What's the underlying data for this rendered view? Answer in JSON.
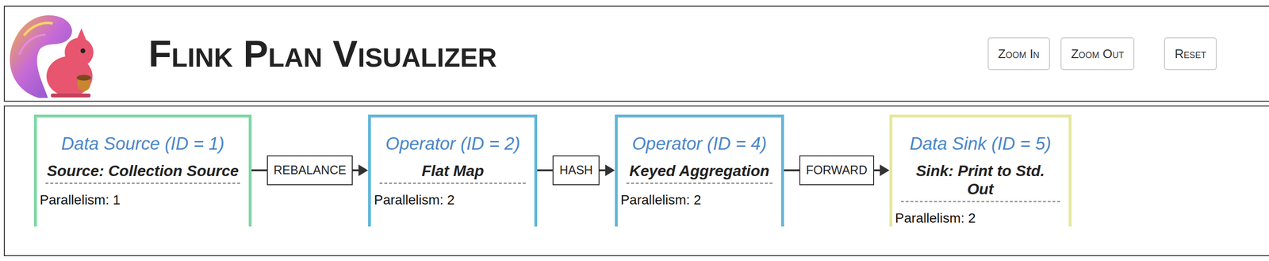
{
  "header": {
    "title": "Flink Plan Visualizer",
    "buttons": [
      "Zoom In",
      "Zoom Out",
      "Reset"
    ]
  },
  "nodes": [
    {
      "kind": "source",
      "title": "Data Source (ID = 1)",
      "name": "Source: Collection Source",
      "parallelism": "Parallelism: 1",
      "color": "#7dd8a3"
    },
    {
      "kind": "operator",
      "title": "Operator (ID = 2)",
      "name": "Flat Map",
      "parallelism": "Parallelism: 2",
      "color": "#62b6d9"
    },
    {
      "kind": "operator",
      "title": "Operator (ID = 4)",
      "name": "Keyed Aggregation",
      "parallelism": "Parallelism: 2",
      "color": "#62b6d9"
    },
    {
      "kind": "sink",
      "title": "Data Sink (ID = 5)",
      "name": "Sink: Print to Std. Out",
      "parallelism": "Parallelism: 2",
      "color": "#e6e89a"
    }
  ],
  "edges": [
    {
      "label": "REBALANCE"
    },
    {
      "label": "HASH"
    },
    {
      "label": "FORWARD"
    }
  ]
}
